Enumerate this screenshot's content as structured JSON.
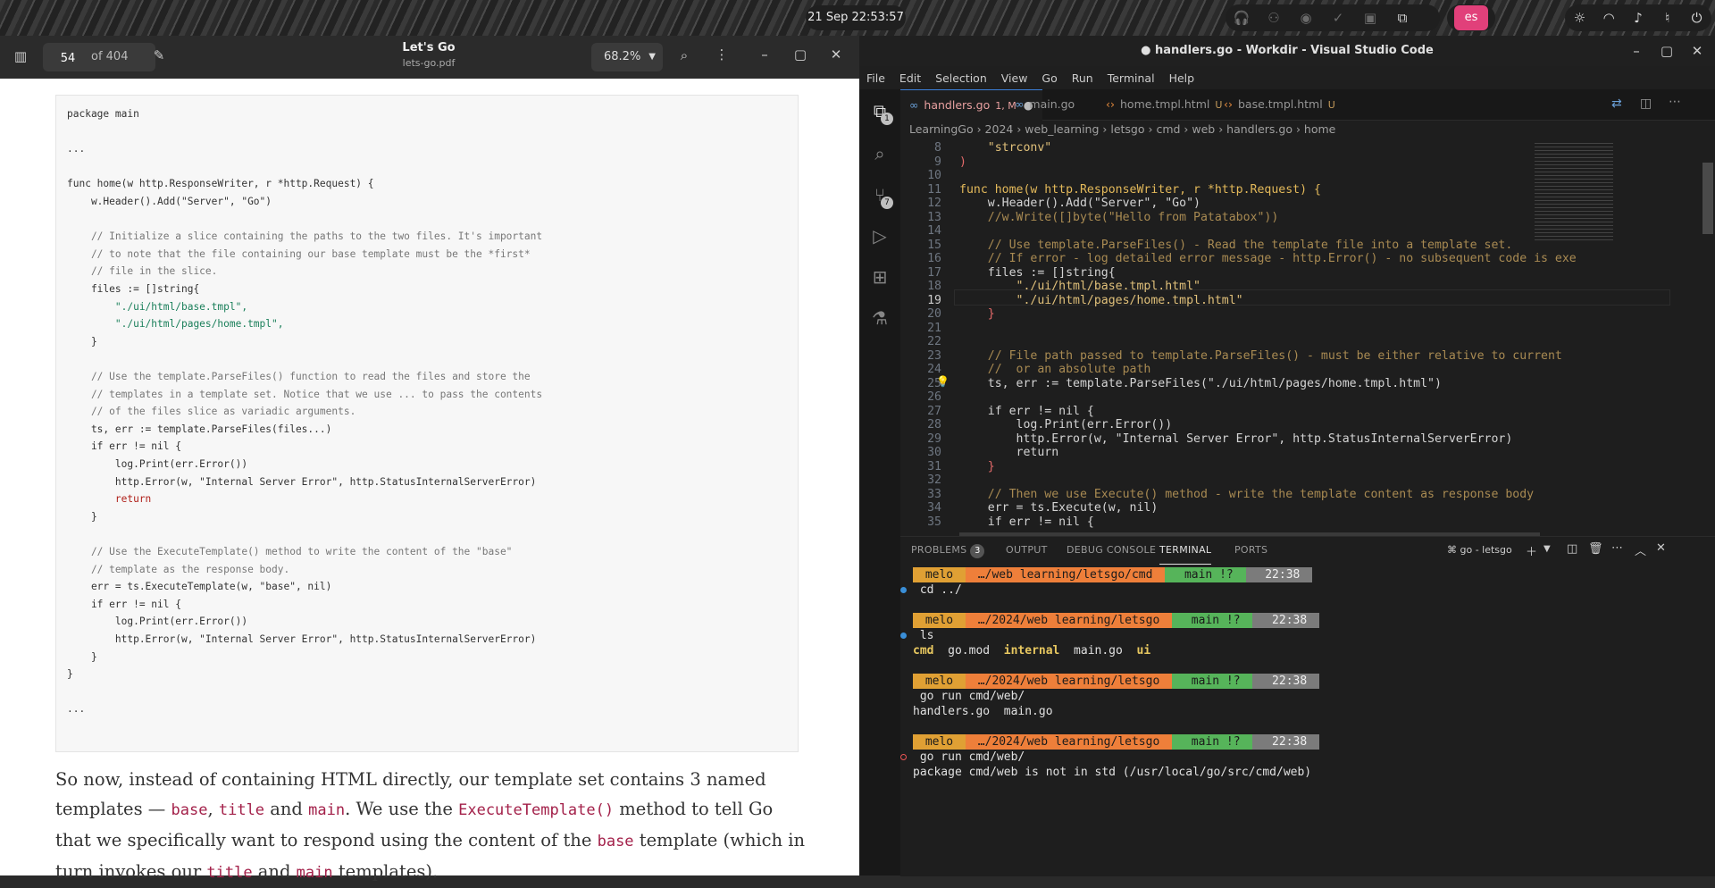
{
  "topbar": {
    "clock": "21 Sep  22:53:57",
    "lang": "es"
  },
  "pdf": {
    "page_current": "54",
    "page_total": "of 404",
    "title": "Let's Go",
    "filename": "lets-go.pdf",
    "zoom": "68.2%",
    "code_lines": [
      {
        "t": "package main",
        "k": ""
      },
      {
        "t": "",
        "k": ""
      },
      {
        "t": "...",
        "k": ""
      },
      {
        "t": "",
        "k": ""
      },
      {
        "t": "func home(w http.ResponseWriter, r *http.Request) {",
        "k": ""
      },
      {
        "t": "    w.Header().Add(\"Server\", \"Go\")",
        "k": ""
      },
      {
        "t": "",
        "k": ""
      },
      {
        "t": "    // Initialize a slice containing the paths to the two files. It's important",
        "k": "c"
      },
      {
        "t": "    // to note that the file containing our base template must be the *first*",
        "k": "c"
      },
      {
        "t": "    // file in the slice.",
        "k": "c"
      },
      {
        "t": "    files := []string{",
        "k": ""
      },
      {
        "t": "        \"./ui/html/base.tmpl\",",
        "k": "s"
      },
      {
        "t": "        \"./ui/html/pages/home.tmpl\",",
        "k": "s"
      },
      {
        "t": "    }",
        "k": ""
      },
      {
        "t": "",
        "k": ""
      },
      {
        "t": "    // Use the template.ParseFiles() function to read the files and store the",
        "k": "c"
      },
      {
        "t": "    // templates in a template set. Notice that we use ... to pass the contents",
        "k": "c"
      },
      {
        "t": "    // of the files slice as variadic arguments.",
        "k": "c"
      },
      {
        "t": "    ts, err := template.ParseFiles(files...)",
        "k": ""
      },
      {
        "t": "    if err != nil {",
        "k": ""
      },
      {
        "t": "        log.Print(err.Error())",
        "k": ""
      },
      {
        "t": "        http.Error(w, \"Internal Server Error\", http.StatusInternalServerError)",
        "k": ""
      },
      {
        "t": "        return",
        "k": "k"
      },
      {
        "t": "    }",
        "k": ""
      },
      {
        "t": "",
        "k": ""
      },
      {
        "t": "    // Use the ExecuteTemplate() method to write the content of the \"base\"",
        "k": "c"
      },
      {
        "t": "    // template as the response body.",
        "k": "c"
      },
      {
        "t": "    err = ts.ExecuteTemplate(w, \"base\", nil)",
        "k": ""
      },
      {
        "t": "    if err != nil {",
        "k": ""
      },
      {
        "t": "        log.Print(err.Error())",
        "k": ""
      },
      {
        "t": "        http.Error(w, \"Internal Server Error\", http.StatusInternalServerError)",
        "k": ""
      },
      {
        "t": "    }",
        "k": ""
      },
      {
        "t": "}",
        "k": ""
      },
      {
        "t": "",
        "k": ""
      },
      {
        "t": "...",
        "k": ""
      }
    ],
    "prose_1": "So now, instead of containing HTML directly, our template set contains 3 named templates — ",
    "prose_base": "base",
    "prose_2": ", ",
    "prose_title": "title",
    "prose_3": " and ",
    "prose_main": "main",
    "prose_4": ". We use the ",
    "prose_exec": "ExecuteTemplate()",
    "prose_5": " method to tell Go that we specifically want to respond using the content of the ",
    "prose_base2": "base",
    "prose_6": " template (which in turn invokes our ",
    "prose_title2": "title",
    "prose_7": " and ",
    "prose_main2": "main",
    "prose_8": " templates)."
  },
  "vscode": {
    "title": "● handlers.go - Workdir - Visual Studio Code",
    "menu": [
      "File",
      "Edit",
      "Selection",
      "View",
      "Go",
      "Run",
      "Terminal",
      "Help"
    ],
    "explorer_badge": "1",
    "scm_badge": "7",
    "tabs": [
      {
        "name": "handlers.go",
        "mod": "1, M"
      },
      {
        "name": "main.go",
        "mod": ""
      },
      {
        "name": "home.tmpl.html",
        "mod": "U"
      },
      {
        "name": "base.tmpl.html",
        "mod": "U"
      }
    ],
    "breadcrumb": "LearningGo  ›  2024  ›  web_learning  ›  letsgo  ›  cmd  ›  web  ›  handlers.go  ›  home",
    "editor_lines": [
      {
        "n": "8",
        "t": "    \"strconv\""
      },
      {
        "n": "9",
        "t": ")"
      },
      {
        "n": "10",
        "t": ""
      },
      {
        "n": "11",
        "t": "func home(w http.ResponseWriter, r *http.Request) {"
      },
      {
        "n": "12",
        "t": "    w.Header().Add(\"Server\", \"Go\")"
      },
      {
        "n": "13",
        "t": "    //w.Write([]byte(\"Hello from Patatabox\"))"
      },
      {
        "n": "14",
        "t": ""
      },
      {
        "n": "15",
        "t": "    // Use template.ParseFiles() - Read the template file into a template set."
      },
      {
        "n": "16",
        "t": "    // If error - log detailed error message - http.Error() - no subsequent code is exe"
      },
      {
        "n": "17",
        "t": "    files := []string{"
      },
      {
        "n": "18",
        "t": "        \"./ui/html/base.tmpl.html\""
      },
      {
        "n": "19",
        "t": "        \"./ui/html/pages/home.tmpl.html\""
      },
      {
        "n": "20",
        "t": "    }"
      },
      {
        "n": "21",
        "t": ""
      },
      {
        "n": "22",
        "t": ""
      },
      {
        "n": "23",
        "t": "    // File path passed to template.ParseFiles() - must be either relative to current"
      },
      {
        "n": "24",
        "t": "    //  or an absolute path"
      },
      {
        "n": "25",
        "t": "    ts, err := template.ParseFiles(\"./ui/html/pages/home.tmpl.html\")"
      },
      {
        "n": "26",
        "t": ""
      },
      {
        "n": "27",
        "t": "    if err != nil {"
      },
      {
        "n": "28",
        "t": "        log.Print(err.Error())"
      },
      {
        "n": "29",
        "t": "        http.Error(w, \"Internal Server Error\", http.StatusInternalServerError)"
      },
      {
        "n": "30",
        "t": "        return"
      },
      {
        "n": "31",
        "t": "    }"
      },
      {
        "n": "32",
        "t": ""
      },
      {
        "n": "33",
        "t": "    // Then we use Execute() method - write the template content as response body"
      },
      {
        "n": "34",
        "t": "    err = ts.Execute(w, nil)"
      },
      {
        "n": "35",
        "t": "    if err != nil {"
      }
    ],
    "panel_tabs": [
      "PROBLEMS",
      "OUTPUT",
      "DEBUG CONSOLE",
      "TERMINAL",
      "PORTS"
    ],
    "problems_count": "3",
    "terminal_name": "go - letsgo",
    "terminal": {
      "p1": {
        "user": " melo ",
        "path": " …/web learning/letsgo/cmd ",
        "git": "  main !? ",
        "time": "  22:38 "
      },
      "c1": " cd ../",
      "p2": {
        "user": " melo ",
        "path": " …/2024/web learning/letsgo ",
        "git": "  main !? ",
        "time": "  22:38 "
      },
      "c2": " ls",
      "ls": [
        "cmd",
        "go.mod",
        "internal",
        "main.go",
        "ui"
      ],
      "p3": {
        "user": " melo ",
        "path": " …/2024/web learning/letsgo ",
        "git": "  main !? ",
        "time": "  22:38 "
      },
      "c3": " go run cmd/web/",
      "o3": "handlers.go  main.go",
      "p4": {
        "user": " melo ",
        "path": " …/2024/web learning/letsgo ",
        "git": "  main !? ",
        "time": "  22:38 "
      },
      "c4": " go run cmd/web/",
      "o4": "package cmd/web is not in std (/usr/local/go/src/cmd/web)"
    }
  }
}
